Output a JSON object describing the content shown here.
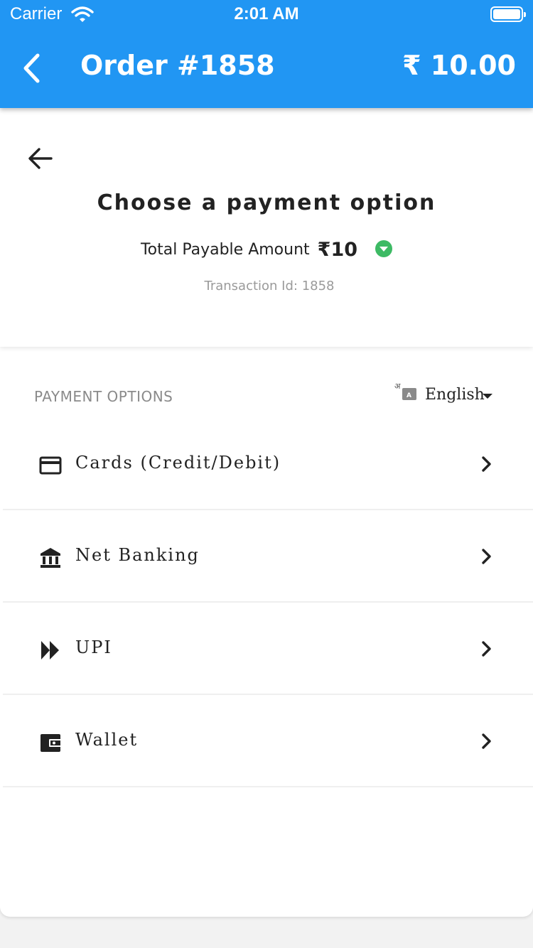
{
  "status_bar": {
    "carrier": "Carrier",
    "time": "2:01 AM"
  },
  "header": {
    "title": "Order #1858",
    "amount": "₹ 10.00"
  },
  "summary": {
    "heading": "Choose a payment option",
    "total_label": "Total Payable Amount",
    "total_amount": "₹10",
    "transaction": "Transaction Id: 1858"
  },
  "options": {
    "section_label": "PAYMENT OPTIONS",
    "language": "English",
    "items": [
      {
        "label": "Cards (Credit/Debit)",
        "icon": "credit-card-icon"
      },
      {
        "label": "Net Banking",
        "icon": "bank-icon"
      },
      {
        "label": "UPI",
        "icon": "upi-icon"
      },
      {
        "label": "Wallet",
        "icon": "wallet-icon"
      }
    ]
  },
  "colors": {
    "primary": "#2196f3",
    "accent_green": "#3dba64",
    "text_dark": "#222222",
    "text_muted": "#9a9a9a"
  }
}
